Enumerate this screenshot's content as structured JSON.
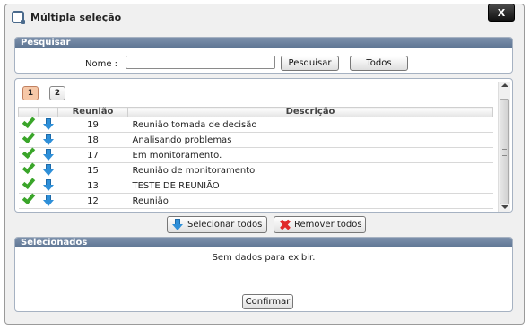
{
  "window": {
    "title": "Múltipla seleção",
    "close_label": "X"
  },
  "search": {
    "header": "Pesquisar",
    "name_label": "Nome :",
    "name_value": "",
    "search_button": "Pesquisar",
    "all_button": "Todos"
  },
  "pagination": {
    "pages": [
      "1",
      "2"
    ],
    "current": "1"
  },
  "table": {
    "columns": [
      "Reunião",
      "Descrição"
    ],
    "rows": [
      {
        "reuniao": "19",
        "descricao": "Reunião tomada de decisão"
      },
      {
        "reuniao": "18",
        "descricao": "Analisando problemas"
      },
      {
        "reuniao": "17",
        "descricao": "Em monitoramento."
      },
      {
        "reuniao": "15",
        "descricao": "Reunião de monitoramento"
      },
      {
        "reuniao": "13",
        "descricao": "TESTE DE REUNIÃO"
      },
      {
        "reuniao": "12",
        "descricao": "Reunião"
      }
    ]
  },
  "actions": {
    "select_all": "Selecionar todos",
    "remove_all": "Remover todos"
  },
  "selected": {
    "header": "Selecionados",
    "empty_text": "Sem dados para exibir.",
    "confirm_button": "Confirmar"
  },
  "colors": {
    "header_bg": "#6b819e",
    "check": "#3aa52a",
    "arrow": "#2e8fd8",
    "remove": "#e02a2a",
    "active_page": "#f6c8a8"
  },
  "icons": {
    "app": "app-logo-icon",
    "check": "check-icon",
    "arrow": "down-arrow-icon",
    "remove": "x-icon"
  }
}
